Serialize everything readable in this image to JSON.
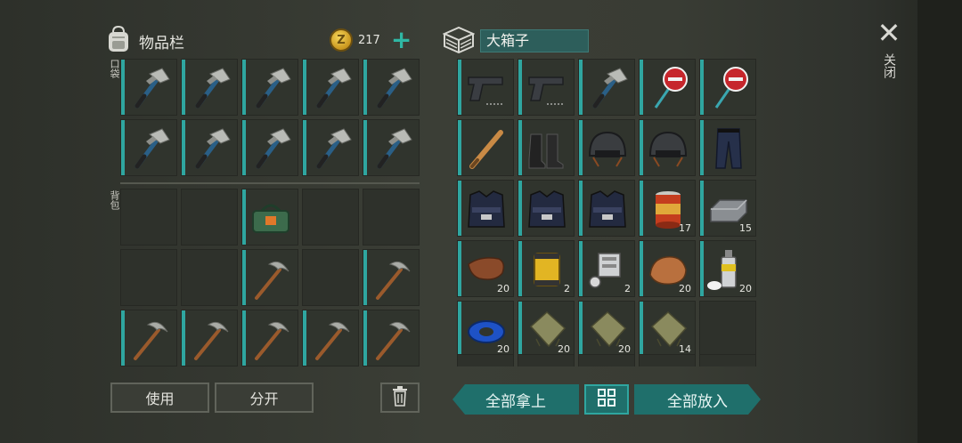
{
  "inventory": {
    "title": "物品栏",
    "coins": "217",
    "coin_symbol": "Z",
    "add_symbol": "+",
    "pockets_label": "口袋",
    "backpack_label": "背包",
    "pockets": [
      {
        "item": "hatchet"
      },
      {
        "item": "hatchet"
      },
      {
        "item": "hatchet"
      },
      {
        "item": "hatchet"
      },
      {
        "item": "hatchet"
      },
      {
        "item": "hatchet"
      },
      {
        "item": "hatchet"
      },
      {
        "item": "hatchet"
      },
      {
        "item": "hatchet"
      },
      {
        "item": "hatchet"
      }
    ],
    "backpack": [
      {
        "item": ""
      },
      {
        "item": ""
      },
      {
        "item": "green-bag"
      },
      {
        "item": ""
      },
      {
        "item": ""
      },
      {
        "item": ""
      },
      {
        "item": ""
      },
      {
        "item": "pickaxe"
      },
      {
        "item": ""
      },
      {
        "item": "pickaxe"
      },
      {
        "item": "pickaxe"
      },
      {
        "item": "pickaxe"
      },
      {
        "item": "pickaxe"
      },
      {
        "item": "pickaxe"
      },
      {
        "item": "pickaxe"
      }
    ],
    "use_button": "使用",
    "split_button": "分开"
  },
  "box": {
    "title": "大箱子",
    "close_label": "关闭",
    "close_symbol": "✕",
    "take_all_button": "全部拿上",
    "put_all_button": "全部放入",
    "slots": [
      {
        "item": "pistol",
        "qty": ""
      },
      {
        "item": "pistol",
        "qty": ""
      },
      {
        "item": "hatchet",
        "qty": ""
      },
      {
        "item": "stop-sign",
        "qty": ""
      },
      {
        "item": "stop-sign",
        "qty": ""
      },
      {
        "item": "baseball-bat",
        "qty": ""
      },
      {
        "item": "boots",
        "qty": ""
      },
      {
        "item": "helmet",
        "qty": ""
      },
      {
        "item": "helmet",
        "qty": ""
      },
      {
        "item": "police-pants",
        "qty": ""
      },
      {
        "item": "police-vest",
        "qty": ""
      },
      {
        "item": "police-vest",
        "qty": ""
      },
      {
        "item": "police-vest",
        "qty": ""
      },
      {
        "item": "canned-food",
        "qty": "17"
      },
      {
        "item": "iron-ingot",
        "qty": "15"
      },
      {
        "item": "leather",
        "qty": "20"
      },
      {
        "item": "oil-filter",
        "qty": "2"
      },
      {
        "item": "engine-parts",
        "qty": "2"
      },
      {
        "item": "stone",
        "qty": "20"
      },
      {
        "item": "spray-can",
        "qty": "20"
      },
      {
        "item": "duct-tape",
        "qty": "20"
      },
      {
        "item": "cloth",
        "qty": "20"
      },
      {
        "item": "cloth",
        "qty": "20"
      },
      {
        "item": "cloth",
        "qty": "14"
      },
      {
        "item": "",
        "qty": ""
      }
    ]
  },
  "colors": {
    "accent": "#2fa6a0",
    "button_teal": "#1f6f6b",
    "panel_bg": "#34372f"
  }
}
